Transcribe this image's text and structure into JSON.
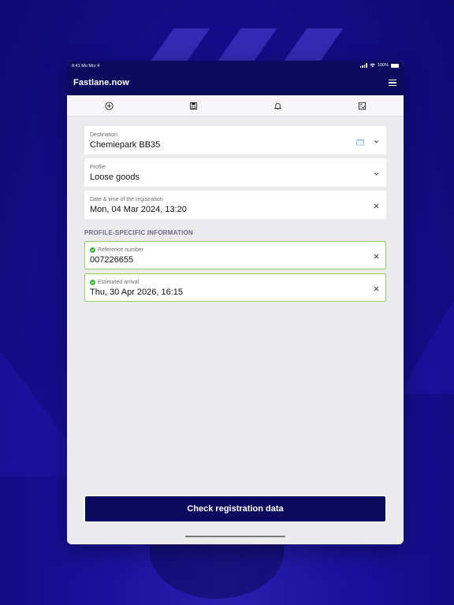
{
  "status_bar": {
    "time": "9:41 Mo Mrz 4",
    "battery": "100%"
  },
  "app": {
    "brand": "Fastlane.now"
  },
  "icons": {
    "menu": "hamburger-menu-icon",
    "tabs": [
      "plus-circle-icon",
      "save-icon",
      "bell-icon",
      "checklist-icon"
    ],
    "destination_extra": "factory-icon",
    "dropdown": "chevron-down-icon",
    "clear": "close-icon",
    "valid": "check-circle-icon"
  },
  "form": {
    "destination": {
      "label": "Destination",
      "value": "Chemiepark BB35"
    },
    "profile": {
      "label": "Profile",
      "value": "Loose goods"
    },
    "registration_datetime": {
      "label": "Date & time of the registration",
      "value": "Mon, 04 Mar 2024, 13:20"
    }
  },
  "profile_section": {
    "title": "PROFILE-SPECIFIC INFORMATION",
    "reference": {
      "label": "Reference number",
      "value": "007226655"
    },
    "arrival": {
      "label": "Estimated arrival",
      "value": "Thu, 30 Apr 2026, 16:15"
    }
  },
  "actions": {
    "check_label": "Check registration data"
  },
  "colors": {
    "primary": "#0b0a5e",
    "valid_border": "#8fd26a",
    "valid_check": "#3bb63b",
    "background": "#1a12a0"
  }
}
